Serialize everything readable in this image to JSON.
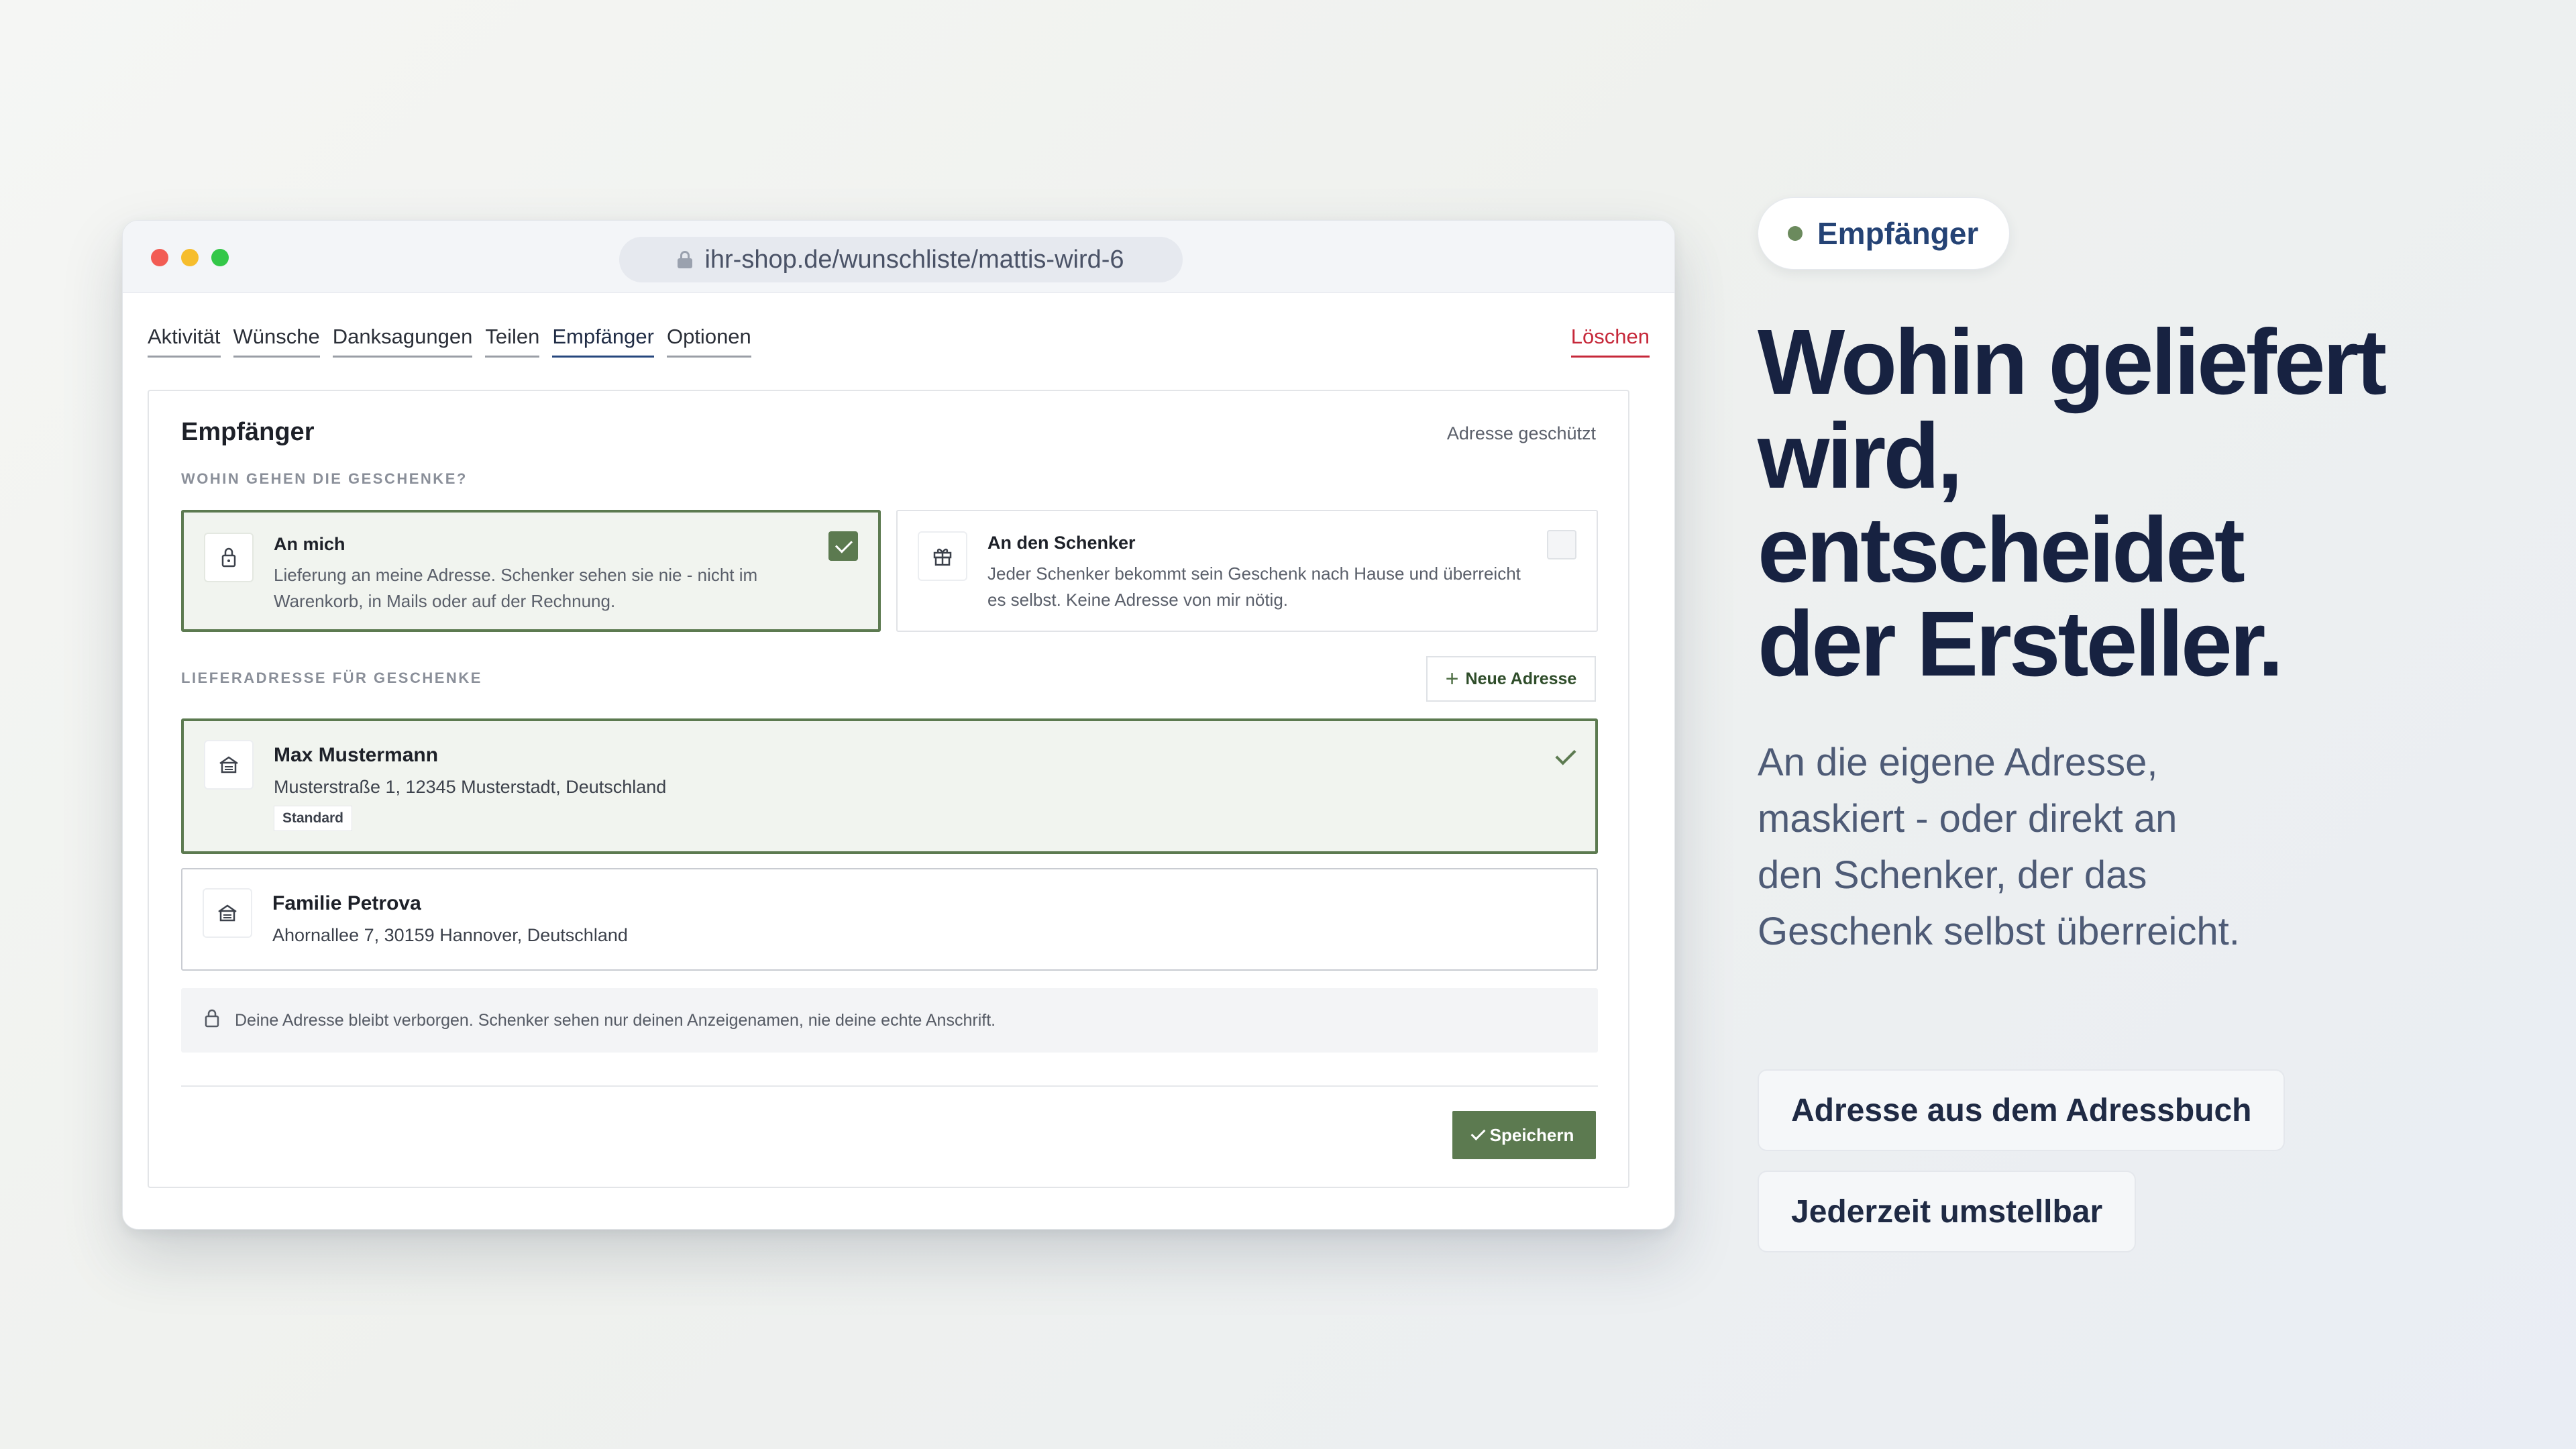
{
  "browser": {
    "url": "ihr-shop.de/wunschliste/mattis-wird-6"
  },
  "tabs": [
    {
      "label": "Aktivität"
    },
    {
      "label": "Wünsche"
    },
    {
      "label": "Danksagungen"
    },
    {
      "label": "Teilen"
    },
    {
      "label": "Empfänger",
      "active": true
    },
    {
      "label": "Optionen"
    }
  ],
  "delete_label": "Löschen",
  "card": {
    "title": "Empfänger",
    "meta": "Adresse geschützt",
    "question_label": "WOHIN GEHEN DIE GESCHENKE?",
    "options": [
      {
        "title": "An mich",
        "description": "Lieferung an meine Adresse. Schenker sehen sie nie - nicht im Warenkorb, in Mails oder auf der Rechnung.",
        "icon": "lock-icon",
        "selected": true
      },
      {
        "title": "An den Schenker",
        "description": "Jeder Schenker bekommt sein Geschenk nach Hause und überreicht es selbst. Keine Adresse von mir nötig.",
        "icon": "gift-icon",
        "selected": false
      }
    ],
    "address_label": "LIEFERADRESSE FÜR GESCHENKE",
    "new_address_label": "Neue Adresse",
    "addresses": [
      {
        "name": "Max Mustermann",
        "line": "Musterstraße 1, 12345 Musterstadt, Deutschland",
        "badge": "Standard",
        "selected": true
      },
      {
        "name": "Familie Petrova",
        "line": "Ahornallee 7, 30159 Hannover, Deutschland",
        "selected": false
      }
    ],
    "notice": "Deine Adresse bleibt verborgen. Schenker sehen nur deinen Anzeigenamen, nie deine echte Anschrift.",
    "save_label": "Speichern"
  },
  "panel": {
    "pill": "Empfänger",
    "headline": [
      "Wohin geliefert",
      "wird,",
      "entscheidet",
      "der Ersteller."
    ],
    "subtext": "An die eigene Adresse, maskiert - oder direkt an den Schenker, der das Geschenk selbst überreicht.",
    "features": [
      "Adresse aus dem Adressbuch",
      "Jederzeit umstellbar"
    ]
  },
  "colors": {
    "accent_green": "#5c7a50",
    "danger_red": "#c6283a",
    "navy": "#172241"
  }
}
